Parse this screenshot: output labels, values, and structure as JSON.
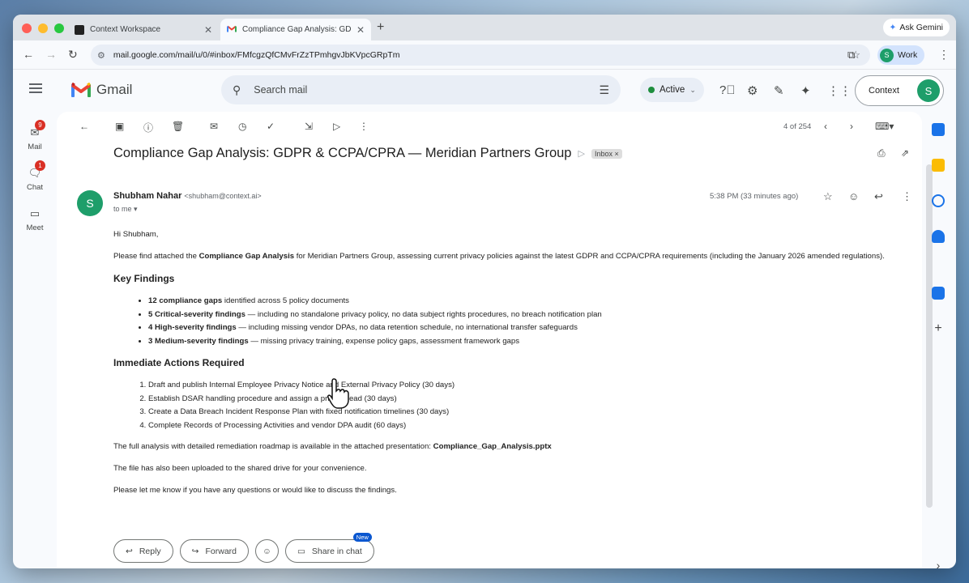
{
  "browser": {
    "tabs": [
      {
        "title": "Context Workspace"
      },
      {
        "title": "Compliance Gap Analysis: GD"
      }
    ],
    "ask_gemini": "Ask Gemini",
    "url": "mail.google.com/mail/u/0/#inbox/FMfcgzQfCMvFrZzTPmhgvJbKVpcGRpTm",
    "profile": {
      "initial": "S",
      "label": "Work"
    }
  },
  "gmail": {
    "logo_text": "Gmail",
    "search_placeholder": "Search mail",
    "status": "Active",
    "context_button": "Context",
    "avatar_initial": "S"
  },
  "rail": [
    {
      "label": "Mail",
      "badge": "9"
    },
    {
      "label": "Chat",
      "badge": "1"
    },
    {
      "label": "Meet",
      "badge": ""
    }
  ],
  "toolbar": {
    "pager": "4 of 254"
  },
  "email": {
    "subject": "Compliance Gap Analysis: GDPR & CCPA/CPRA — Meridian Partners Group",
    "label": "Inbox",
    "sender_name": "Shubham Nahar",
    "sender_email": "<shubham@context.ai>",
    "recipient": "to me",
    "time": "5:38 PM (33 minutes ago)",
    "sender_initial": "S",
    "greeting": "Hi Shubham,",
    "intro_before": "Please find attached the ",
    "intro_bold": "Compliance Gap Analysis",
    "intro_after": " for Meridian Partners Group, assessing current privacy policies against the latest GDPR and CCPA/CPRA requirements (including the January 2026 amended regulations).",
    "key_findings_heading": "Key Findings",
    "findings": [
      {
        "bold": "12 compliance gaps",
        "text": " identified across 5 policy documents"
      },
      {
        "bold": "5 Critical-severity findings",
        "text": " — including no standalone privacy policy, no data subject rights procedures, no breach notification plan"
      },
      {
        "bold": "4 High-severity findings",
        "text": " — including missing vendor DPAs, no data retention schedule, no international transfer safeguards"
      },
      {
        "bold": "3 Medium-severity findings",
        "text": " — missing privacy training, expense policy gaps, assessment framework gaps"
      }
    ],
    "actions_heading": "Immediate Actions Required",
    "actions": [
      "Draft and publish Internal Employee Privacy Notice and External Privacy Policy (30 days)",
      "Establish DSAR handling procedure and assign a privacy lead (30 days)",
      "Create a Data Breach Incident Response Plan with fixed notification timelines (30 days)",
      "Complete Records of Processing Activities and vendor DPA audit (60 days)"
    ],
    "closing_before": "The full analysis with detailed remediation roadmap is available in the attached presentation: ",
    "closing_bold": "Compliance_Gap_Analysis.pptx",
    "drive_note": "The file has also been uploaded to the shared drive for your convenience.",
    "signoff": "Please let me know if you have any questions or would like to discuss the findings."
  },
  "reply_bar": {
    "reply": "Reply",
    "forward": "Forward",
    "share": "Share in chat",
    "new_badge": "New"
  }
}
